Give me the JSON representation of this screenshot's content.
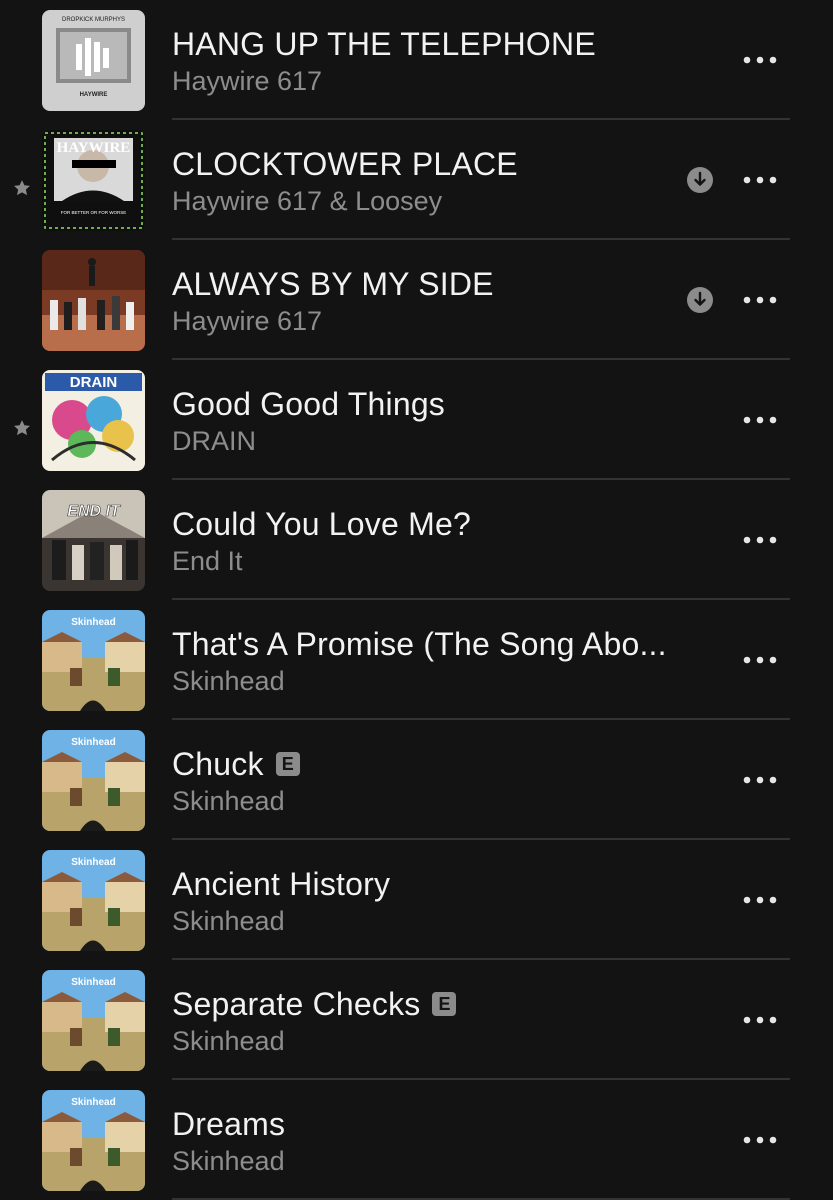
{
  "colors": {
    "background": "#131313",
    "title_text": "#f2f2f2",
    "subtitle_text": "#8d8d8d",
    "icon_gray": "#8b8b8b",
    "divider": "#333333"
  },
  "songs": [
    {
      "title": "HANG UP THE TELEPHONE",
      "artist": "Haywire 617",
      "art_text_top": "DROPKICK MURPHYS",
      "art_text_bottom": "HAYWIRE",
      "favorite": false,
      "explicit": false,
      "downloaded": false,
      "icon": "more-icon"
    },
    {
      "title": "CLOCKTOWER PLACE",
      "artist": "Haywire 617 & Loosey",
      "art_text_top": "HAYWIRE",
      "art_text_bottom": "FOR BETTER OR FOR WORSE",
      "favorite": true,
      "explicit": false,
      "downloaded": true
    },
    {
      "title": "ALWAYS BY MY SIDE",
      "artist": "Haywire 617",
      "favorite": false,
      "explicit": false,
      "downloaded": true
    },
    {
      "title": "Good Good Things",
      "artist": "DRAIN",
      "art_text_top": "DRAIN",
      "favorite": true,
      "explicit": false,
      "downloaded": false
    },
    {
      "title": "Could You Love Me?",
      "artist": "End It",
      "art_text_top": "END IT",
      "favorite": false,
      "explicit": false,
      "downloaded": false
    },
    {
      "title": "That's A Promise (The Song Abo...",
      "artist": "Skinhead",
      "art_text_top": "Skinhead",
      "favorite": false,
      "explicit": false,
      "downloaded": false
    },
    {
      "title": "Chuck",
      "artist": "Skinhead",
      "art_text_top": "Skinhead",
      "favorite": false,
      "explicit": true,
      "explicit_label": "E",
      "downloaded": false
    },
    {
      "title": "Ancient History",
      "artist": "Skinhead",
      "art_text_top": "Skinhead",
      "favorite": false,
      "explicit": false,
      "downloaded": false
    },
    {
      "title": "Separate Checks",
      "artist": "Skinhead",
      "art_text_top": "Skinhead",
      "favorite": false,
      "explicit": true,
      "explicit_label": "E",
      "downloaded": false
    },
    {
      "title": "Dreams",
      "artist": "Skinhead",
      "art_text_top": "Skinhead",
      "favorite": false,
      "explicit": false,
      "downloaded": false
    }
  ]
}
